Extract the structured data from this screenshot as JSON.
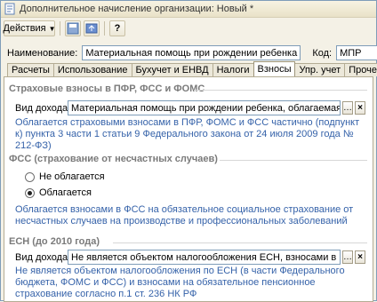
{
  "window": {
    "title": "Дополнительное начисление организации: Новый *"
  },
  "toolbar": {
    "actions_label": "Действия",
    "help_label": "?"
  },
  "header": {
    "name_label": "Наименование:",
    "name_value": "Материальная помощь при рождении ребенка",
    "code_label": "Код:",
    "code_value": "МПР"
  },
  "tabs": [
    {
      "label": "Расчеты"
    },
    {
      "label": "Использование"
    },
    {
      "label": "Бухучет и ЕНВД"
    },
    {
      "label": "Налоги"
    },
    {
      "label": "Взносы"
    },
    {
      "label": "Упр. учет"
    },
    {
      "label": "Прочее"
    }
  ],
  "active_tab": "Взносы",
  "insurance": {
    "title": "Страховые взносы в ПФР, ФСС и ФОМС",
    "income_label": "Вид дохода:",
    "income_value": "Материальная помощь при рождении ребенка, облагаемая страх",
    "note": "Облагается страховыми взносами в ПФР, ФОМС и ФСС частично (подпункт к) пункта 3 части 1 статьи 9 Федерального закона от 24 июля 2009 года № 212-ФЗ)"
  },
  "fss": {
    "title": "ФСС (страхование от несчастных случаев)",
    "option1": "Не облагается",
    "option2": "Облагается",
    "selected": "Облагается",
    "note": "Облагается взносами в ФСС на обязательное социальное страхование от несчастных случаев на производстве и профессиональных заболеваний"
  },
  "esn": {
    "title": "ЕСН (до 2010 года)",
    "income_label": "Вид дохода:",
    "income_value": "Не является объектом налогообложения ЕСН, взносами в ПФР с",
    "note": "Не является объектом налогообложения по ЕСН (в части Федерального бюджета, ФОМС и ФСС) и взносами на обязательное пенсионное страхование согласно п.1 ст. 236 НК РФ"
  }
}
